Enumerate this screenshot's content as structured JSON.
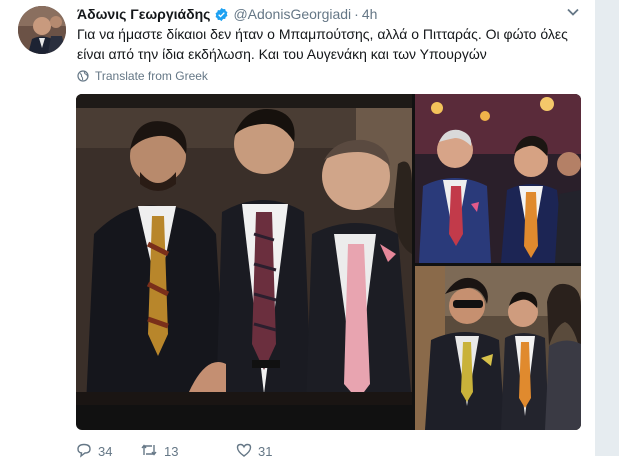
{
  "tweet": {
    "author_name": "Άδωνις Γεωργιάδης",
    "handle": "@AdonisGeorgiadi",
    "separator": "·",
    "time": "4h",
    "text": "Για να ήμαστε δίκαιοι δεν ήταν ο Μπαμπούτσης, αλλά ο Πιτταράς. Οι φώτο όλες είναι από την ίδια εκδήλωση. Και του Αυγενάκη και των Υπουργών",
    "translate_label": "Translate from Greek"
  },
  "actions": {
    "reply_count": "34",
    "retweet_count": "13",
    "like_count": "31"
  },
  "colors": {
    "secondary_text": "#657786",
    "verified": "#1da1f2",
    "link": "#1b95e0"
  },
  "icons": [
    "verified-icon",
    "chevron-down-icon",
    "globe-icon",
    "reply-icon",
    "retweet-icon",
    "like-icon"
  ]
}
